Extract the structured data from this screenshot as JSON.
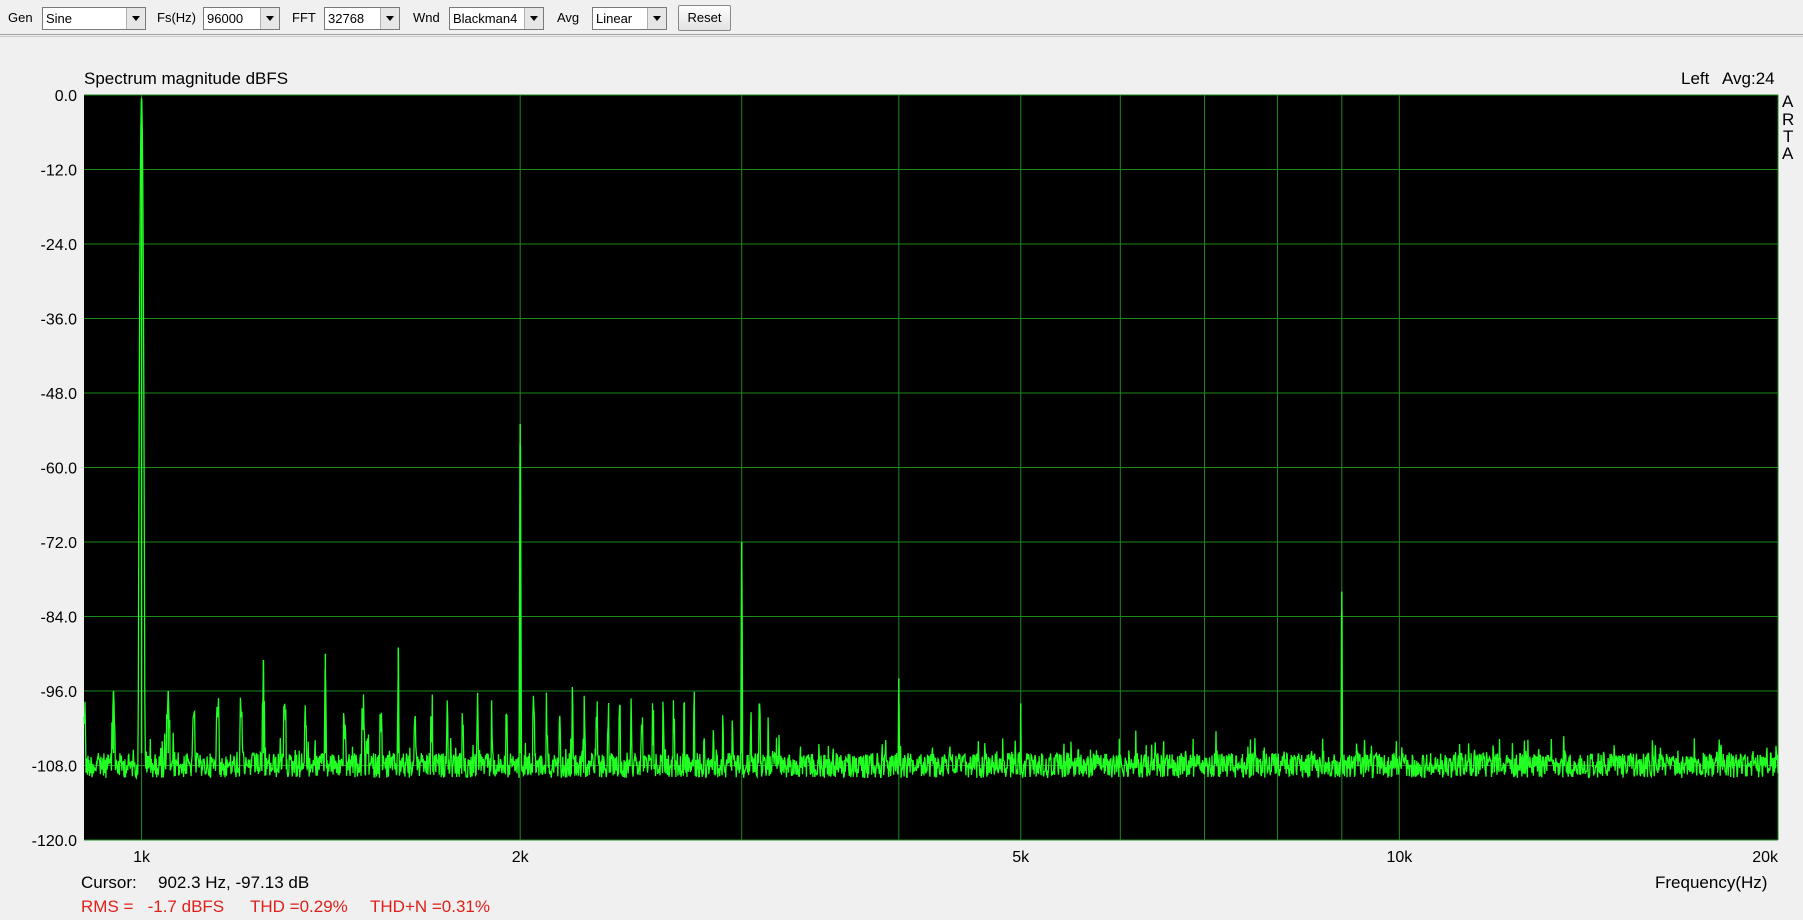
{
  "toolbar": {
    "gen_label": "Gen",
    "gen_value": "Sine",
    "fs_label": "Fs(Hz)",
    "fs_value": "96000",
    "fft_label": "FFT",
    "fft_value": "32768",
    "wnd_label": "Wnd",
    "wnd_value": "Blackman4",
    "avg_label": "Avg",
    "avg_value": "Linear",
    "reset_label": "Reset"
  },
  "plot": {
    "channel": "Left",
    "avg": "Avg:24",
    "brand": [
      "A",
      "R",
      "T",
      "A"
    ]
  },
  "cursor": {
    "label": "Cursor:",
    "value": "902.3 Hz, -97.13 dB"
  },
  "stats": {
    "rms": "RMS =   -1.7 dBFS",
    "thd": "THD =0.29%",
    "thdn": "THD+N =0.31%"
  },
  "colors": {
    "plot_bg": "#000000",
    "grid": "#1c8a1c",
    "trace": "#22ff22",
    "stats_text": "#e0201a"
  },
  "chart_data": {
    "type": "line",
    "title": "Spectrum magnitude dBFS",
    "xlabel": "Frequency(Hz)",
    "ylabel": "",
    "x_scale": "log",
    "xlim": [
      900,
      20000
    ],
    "ylim": [
      -120,
      0
    ],
    "y_ticks": [
      0,
      -12,
      -24,
      -36,
      -48,
      -60,
      -72,
      -84,
      -96,
      -108,
      -120
    ],
    "y_tick_labels": [
      "0.0",
      "-12.0",
      "-24.0",
      "-36.0",
      "-48.0",
      "-60.0",
      "-72.0",
      "-84.0",
      "-96.0",
      "-108.0",
      "-120.0"
    ],
    "x_ticks": [
      1000,
      2000,
      5000,
      10000,
      20000
    ],
    "x_tick_labels": [
      "1k",
      "2k",
      "5k",
      "10k",
      "20k"
    ],
    "x_minor_grid": [
      3000,
      4000,
      6000,
      7000,
      8000,
      9000
    ],
    "grid": true,
    "noise_floor_db": -106,
    "peaks": [
      {
        "freq": 1000,
        "db": -0.5
      },
      {
        "freq": 2000,
        "db": -53
      },
      {
        "freq": 3000,
        "db": -72
      },
      {
        "freq": 9000,
        "db": -80
      },
      {
        "freq": 1400,
        "db": -90
      },
      {
        "freq": 1600,
        "db": -89
      },
      {
        "freq": 1250,
        "db": -91
      },
      {
        "freq": 4000,
        "db": -94
      },
      {
        "freq": 5000,
        "db": -98
      },
      {
        "freq": 950,
        "db": -96
      },
      {
        "freq": 1050,
        "db": -96
      }
    ]
  }
}
